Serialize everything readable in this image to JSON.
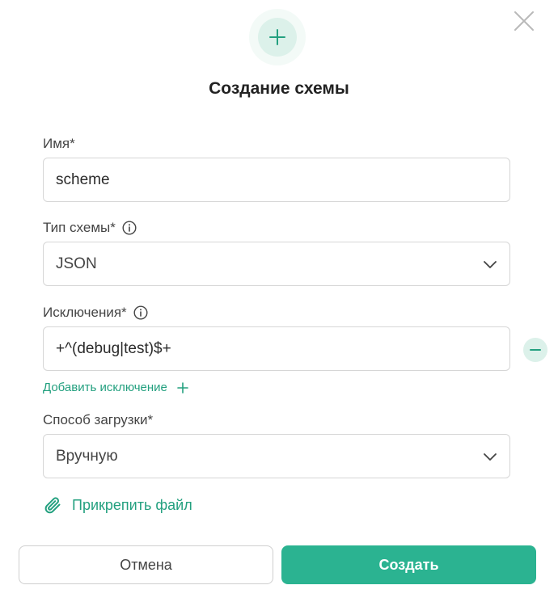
{
  "dialog": {
    "title": "Создание схемы",
    "close_icon": "close-icon",
    "header_icon": "plus-icon",
    "accent_color": "#2bb391"
  },
  "form": {
    "name": {
      "label": "Имя*",
      "value": "scheme"
    },
    "scheme_type": {
      "label": "Тип схемы*",
      "value": "JSON",
      "icon": "info-icon"
    },
    "exclusions": {
      "label": "Исключения*",
      "value": "+^(debug|test)$+",
      "icon": "info-icon"
    },
    "add_exclusion_label": "Добавить исключение",
    "upload_method": {
      "label": "Способ загрузки*",
      "value": "Вручную"
    },
    "attach_file_label": "Прикрепить файл"
  },
  "buttons": {
    "cancel": "Отмена",
    "create": "Создать"
  }
}
